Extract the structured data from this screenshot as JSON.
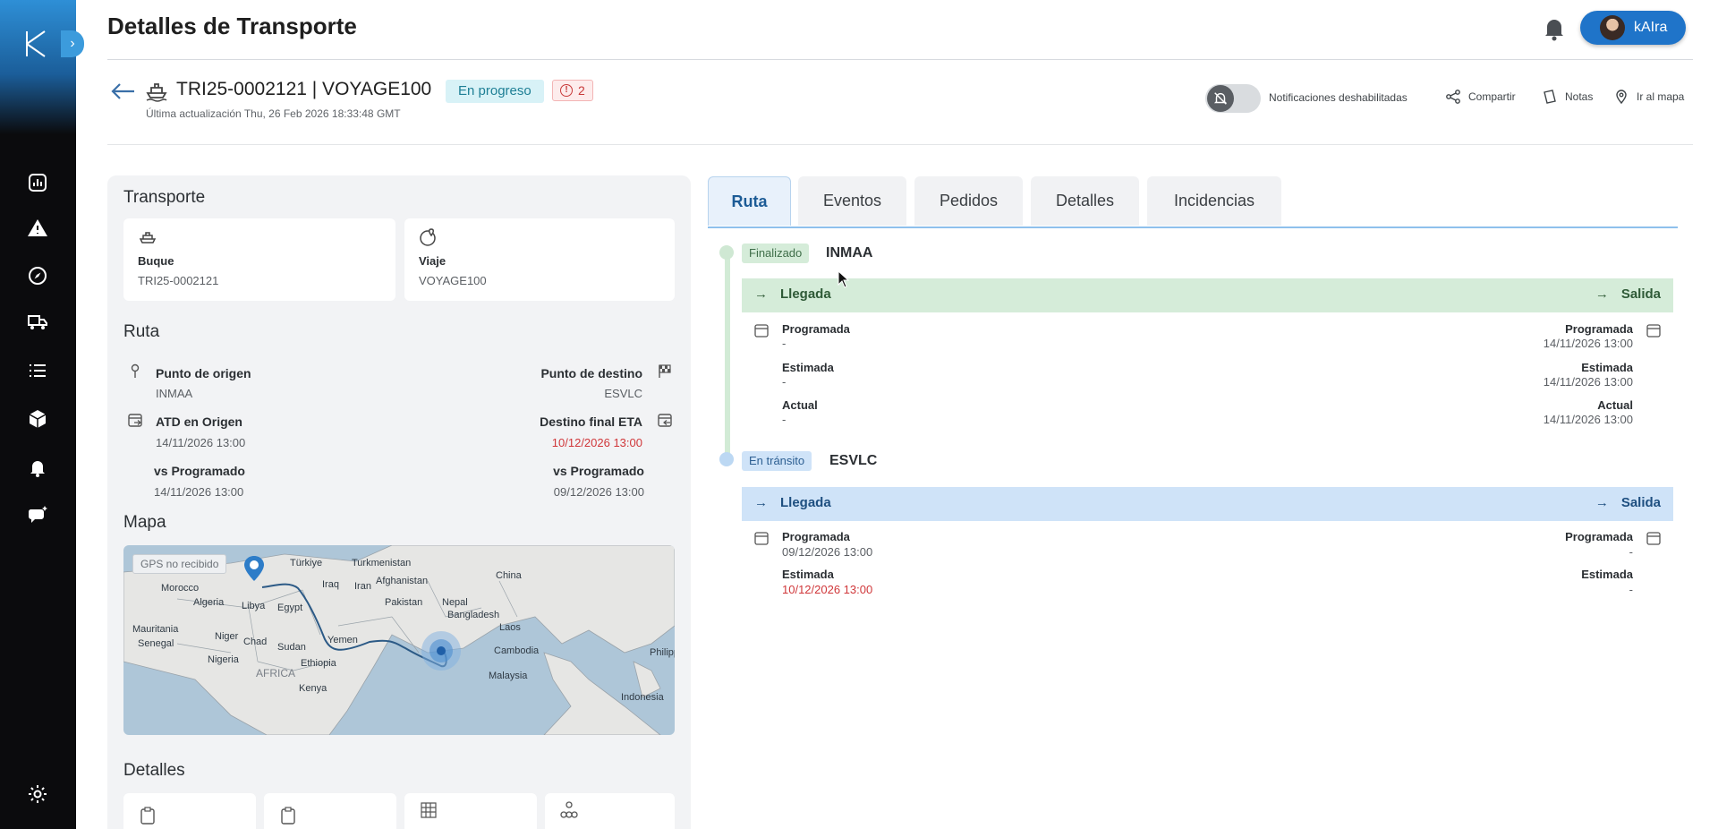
{
  "app": {
    "page_title": "Detalles de Transporte",
    "user_name": "kAIra"
  },
  "trip": {
    "id": "TRI25-0002121 | VOYAGE100",
    "status": "En progreso",
    "alerts_count": "2",
    "last_update": "Última actualización Thu, 26 Feb 2026 18:33:48 GMT"
  },
  "header_actions": {
    "notifications_label": "Notificaciones deshabilitadas",
    "share_label": "Compartir",
    "notes_label": "Notas",
    "map_label": "Ir al mapa"
  },
  "left": {
    "transport_title": "Transporte",
    "vessel_label": "Buque",
    "vessel_value": "TRI25-0002121",
    "voyage_label": "Viaje",
    "voyage_value": "VOYAGE100",
    "route_title": "Ruta",
    "origin_label": "Punto de origen",
    "origin_value": "INMAA",
    "dest_label": "Punto de destino",
    "dest_value": "ESVLC",
    "atd_label": "ATD en Origen",
    "atd_value": "14/11/2026 13:00",
    "eta_label": "Destino final ETA",
    "eta_value": "10/12/2026 13:00",
    "vs_prog_label_left": "vs Programado",
    "vs_prog_value_left": "14/11/2026 13:00",
    "vs_prog_label_right": "vs Programado",
    "vs_prog_value_right": "09/12/2026 13:00",
    "map_title": "Mapa",
    "gps_label": "GPS no recibido",
    "details_title": "Detalles",
    "map_labels": [
      "Türkiye",
      "Turkmenistan",
      "Morocco",
      "Algeria",
      "Libya",
      "Egypt",
      "Iraq",
      "Iran",
      "Afghanistan",
      "China",
      "Pakistan",
      "Nepal",
      "Bangladesh",
      "Mauritania",
      "Senegal",
      "Niger",
      "Chad",
      "Sudan",
      "Nigeria",
      "Ethiopia",
      "Yemen",
      "Laos",
      "Cambodia",
      "Philipp",
      "Malaysia",
      "Indonesia",
      "AFRICA",
      "Kenya"
    ]
  },
  "tabs": [
    "Ruta",
    "Eventos",
    "Pedidos",
    "Detalles",
    "Incidencias"
  ],
  "route": {
    "stop1": {
      "badge": "Finalizado",
      "code": "INMAA",
      "arrival": "Llegada",
      "departure": "Salida",
      "prog_label": "Programada",
      "prog_left": "-",
      "prog_right": "14/11/2026 13:00",
      "est_label": "Estimada",
      "est_left": "-",
      "est_right": "14/11/2026 13:00",
      "act_label": "Actual",
      "act_left": "-",
      "act_right": "14/11/2026 13:00"
    },
    "stop2": {
      "badge": "En tránsito",
      "code": "ESVLC",
      "arrival": "Llegada",
      "departure": "Salida",
      "prog_label": "Programada",
      "prog_left": "09/12/2026 13:00",
      "prog_right": "-",
      "est_label": "Estimada",
      "est_left": "10/12/2026 13:00",
      "est_right": "-"
    }
  },
  "colors": {
    "accent": "#1f74c9",
    "finished_green": "#d5ecd9",
    "transit_blue": "#cfe3f8",
    "late_red": "#d0373a"
  }
}
